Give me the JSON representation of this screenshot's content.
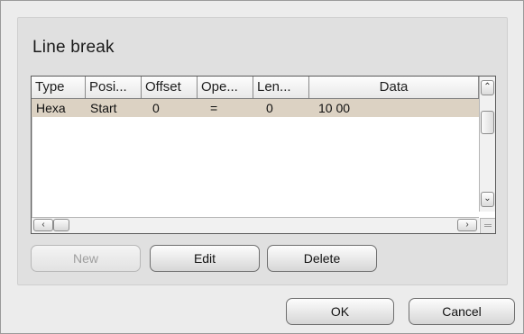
{
  "group": {
    "title": "Line break"
  },
  "table": {
    "columns": [
      "Type",
      "Posi...",
      "Offset",
      "Ope...",
      "Len...",
      "Data"
    ],
    "rows": [
      {
        "type": "Hexa",
        "position": "Start",
        "offset": "0",
        "operator": "=",
        "length": "0",
        "data": "10 00"
      }
    ]
  },
  "scroll": {
    "up_icon": "chevron-up-icon",
    "down_icon": "chevron-down-icon",
    "left_icon": "chevron-left-icon",
    "right_icon": "chevron-right-icon"
  },
  "buttons": {
    "new": "New",
    "edit": "Edit",
    "delete": "Delete",
    "ok": "OK",
    "cancel": "Cancel"
  },
  "colors": {
    "selected_row": "#dcd2c3",
    "disabled_text": "#9e9e9e"
  }
}
